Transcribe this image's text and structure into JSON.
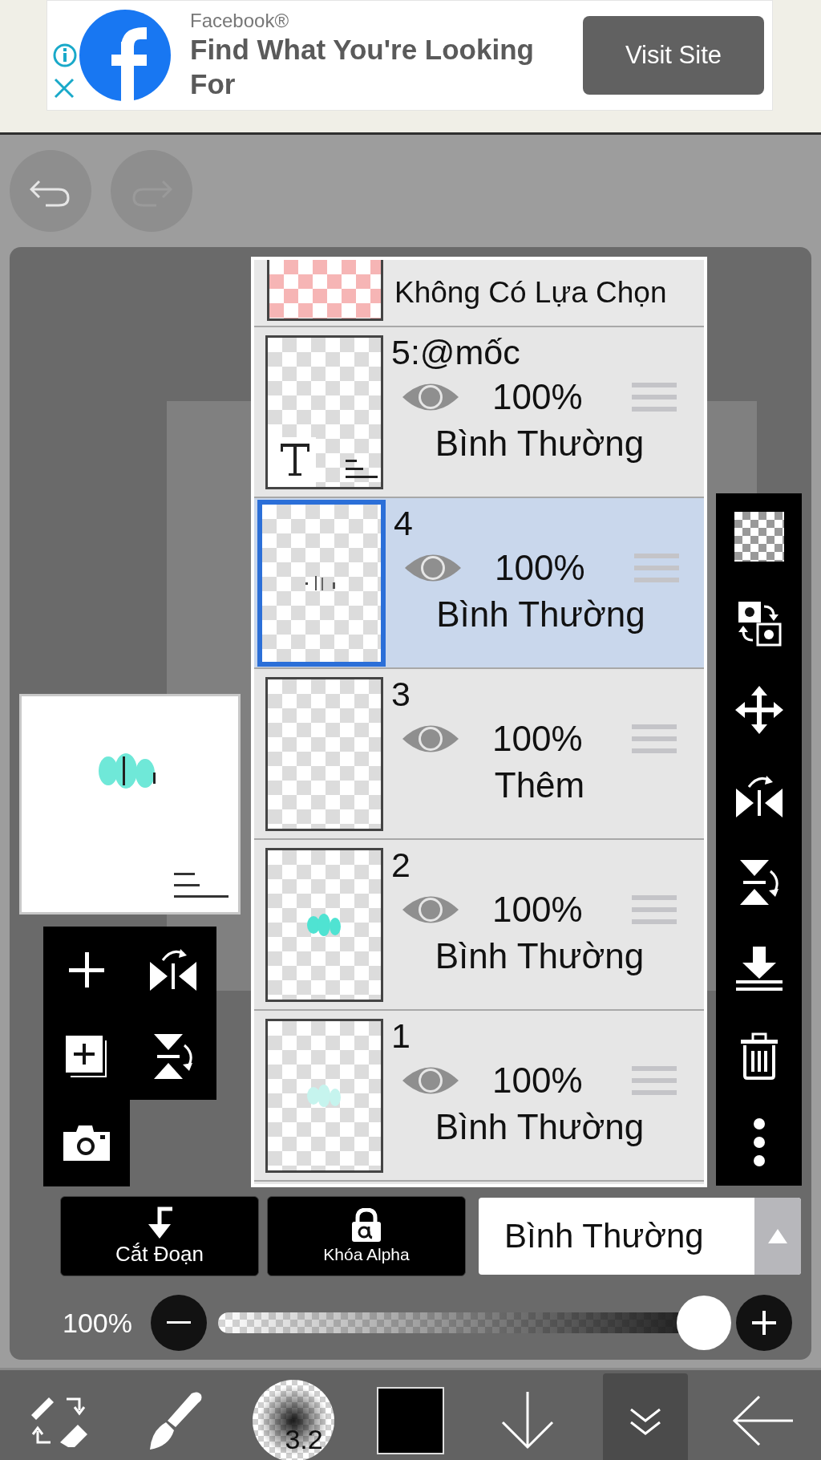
{
  "ad": {
    "advertiser": "Facebook®",
    "headline": "Find What You're Looking For",
    "button": "Visit Site"
  },
  "layers_panel": {
    "selection_layer": {
      "label": "Không Có Lựa Chọn"
    },
    "layers": [
      {
        "name": "5:@mốc",
        "visible": true,
        "opacity": "100%",
        "blend_mode": "Bình Thường",
        "selected": false,
        "kind": "text_layer"
      },
      {
        "name": "4",
        "visible": true,
        "opacity": "100%",
        "blend_mode": "Bình Thường",
        "selected": true,
        "kind": "specks"
      },
      {
        "name": "3",
        "visible": true,
        "opacity": "100%",
        "blend_mode": "Thêm",
        "selected": false,
        "kind": "empty"
      },
      {
        "name": "2",
        "visible": true,
        "opacity": "100%",
        "blend_mode": "Bình Thường",
        "selected": false,
        "kind": "drawing"
      },
      {
        "name": "1",
        "visible": true,
        "opacity": "100%",
        "blend_mode": "Bình Thường",
        "selected": false,
        "kind": "faint_drawing"
      }
    ]
  },
  "layer_buttons": [
    {
      "label": "Cắt Đoạn",
      "kind": "clip"
    },
    {
      "label": "Khóa Alpha",
      "kind": "alpha_lock"
    }
  ],
  "blend_dropdown": {
    "value": "Bình Thường"
  },
  "opacity_slider": {
    "reading": "100%",
    "level": 1.0
  },
  "bottom_toolbar": {
    "brush_size": "3.2",
    "tools": [
      {
        "kind": "swap",
        "selected": false
      },
      {
        "kind": "brush",
        "selected": false
      },
      {
        "kind": "size",
        "selected": false
      },
      {
        "kind": "color",
        "selected": false
      },
      {
        "kind": "down",
        "selected": false
      },
      {
        "kind": "layers",
        "selected": true
      },
      {
        "kind": "back",
        "selected": false
      }
    ]
  }
}
